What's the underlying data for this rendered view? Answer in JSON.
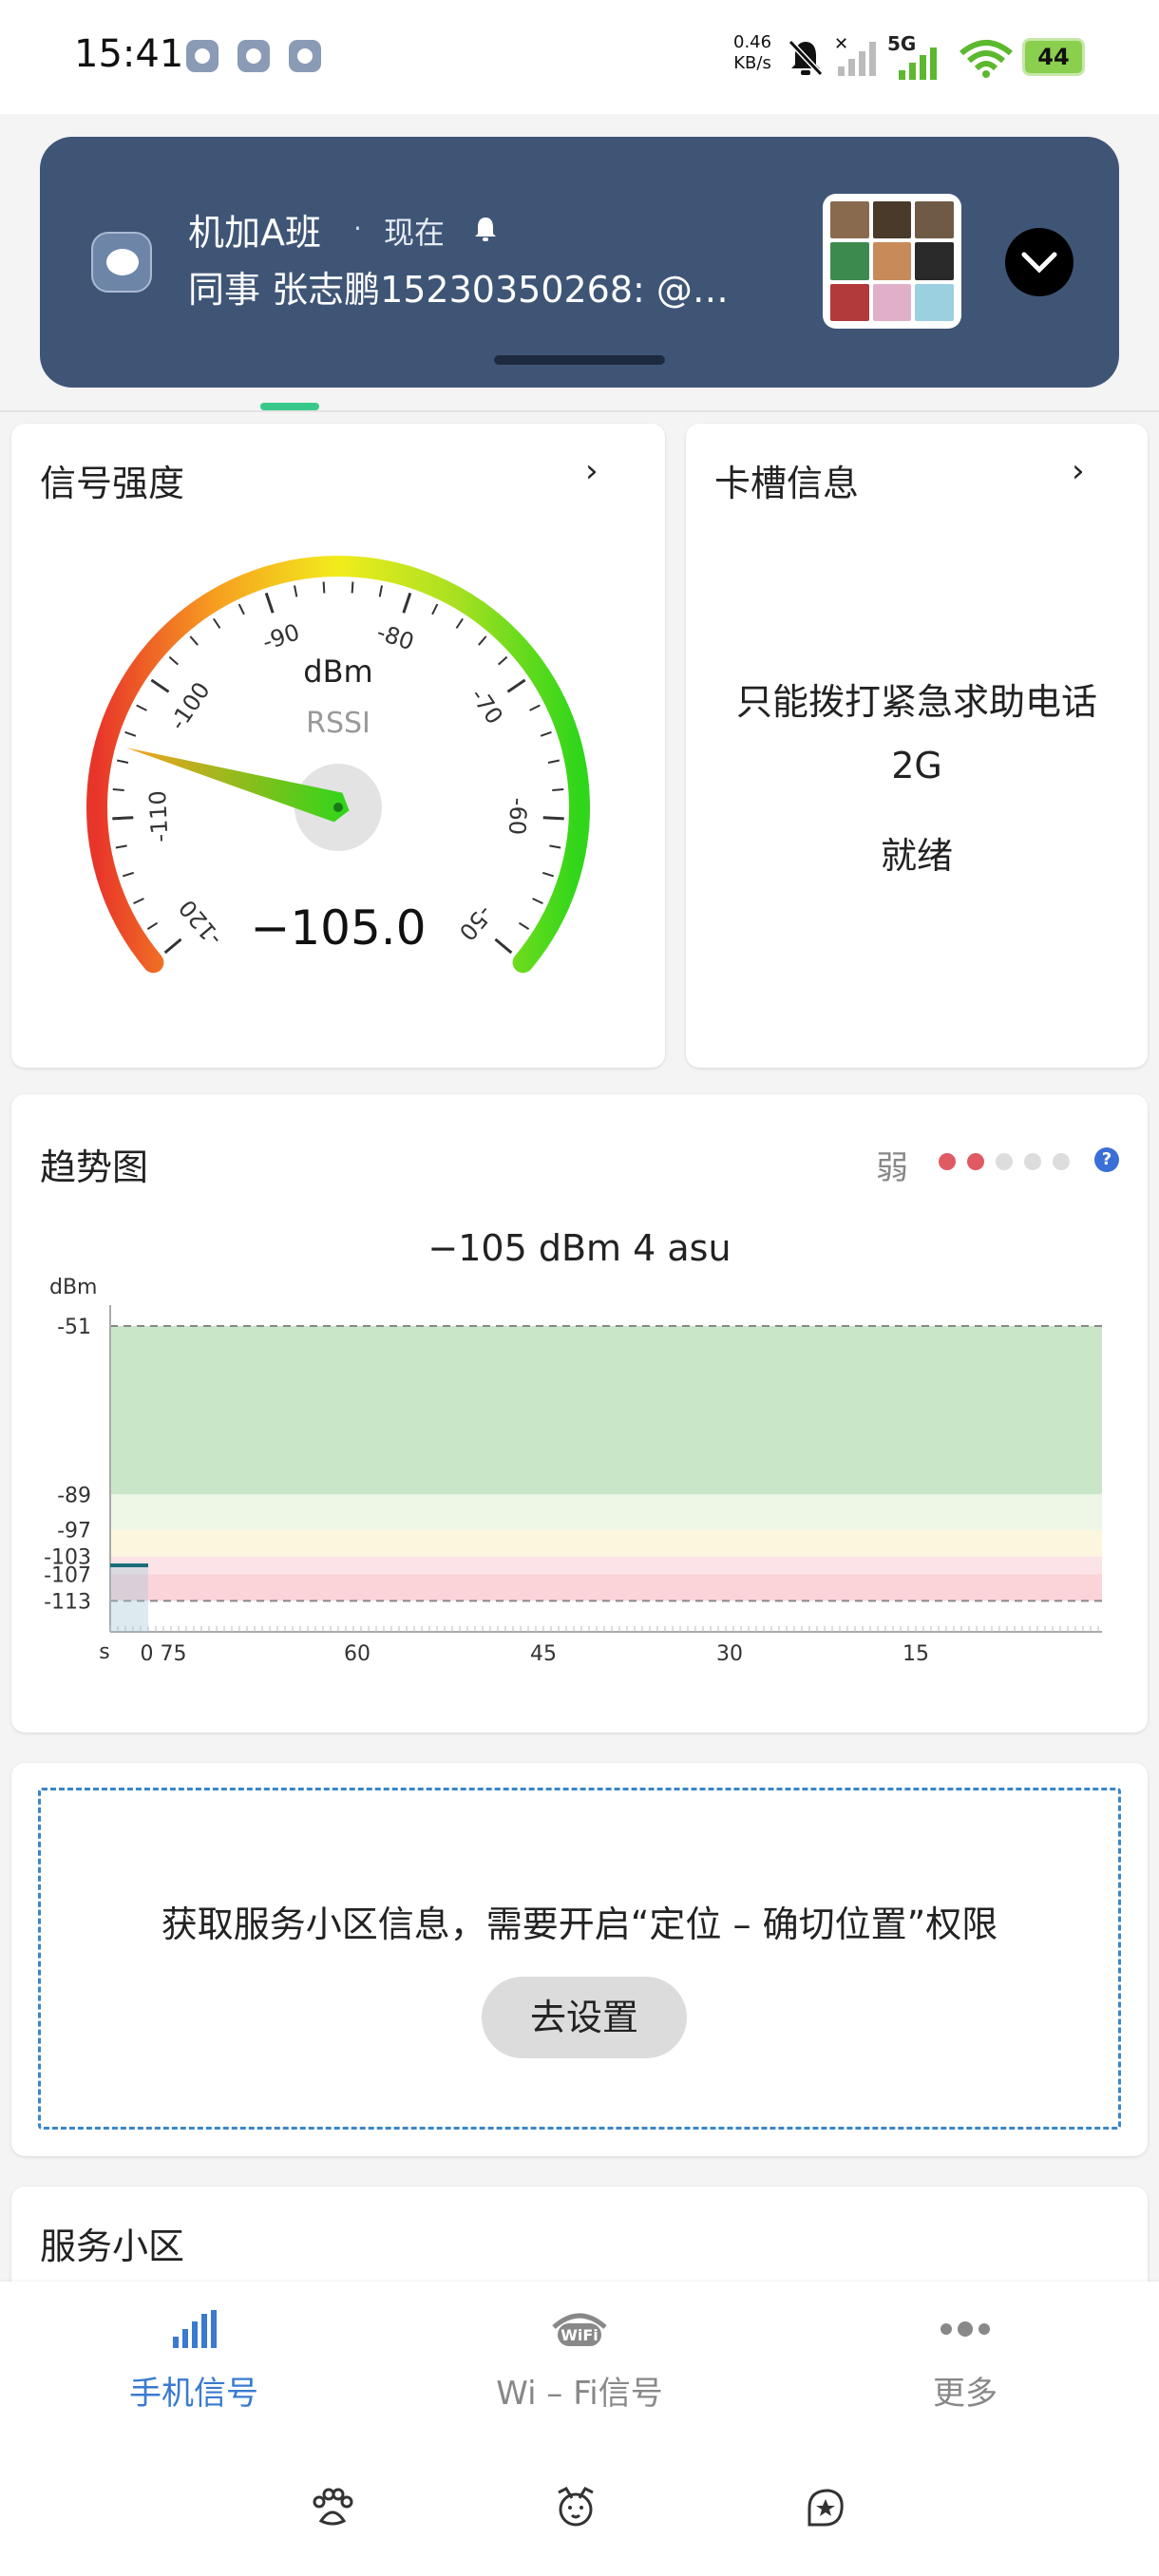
{
  "status_bar": {
    "time": "15:41",
    "net_speed": "0.46",
    "net_unit": "KB/s",
    "network_type": "5G",
    "battery": "44",
    "icons": [
      "chat-app-icon",
      "tiktok-icon",
      "shield-off-icon",
      "mute-bell-icon",
      "no-signal-icon",
      "signal-icon",
      "wifi-icon",
      "battery-icon"
    ]
  },
  "notification": {
    "title": "机加A班",
    "separator": "·",
    "time": "现在",
    "message": "同事   张志鹏15230350268: @…",
    "icons": [
      "chat-app-icon",
      "alarm-bell-icon",
      "thumbnail-grid",
      "chevron-down-icon"
    ]
  },
  "signal_card": {
    "title": "信号强度",
    "unit": "dBm",
    "subtitle": "RSSI",
    "value": "−105.0",
    "gauge": {
      "min": -120,
      "max": -50,
      "reading": -105
    },
    "ticks": [
      "-120",
      "-110",
      "-100",
      "-90",
      "-80",
      "-70",
      "-60",
      "-50"
    ]
  },
  "sim_card": {
    "title": "卡槽信息",
    "lines": [
      "只能拨打紧急求助电话",
      "2G",
      "就绪"
    ]
  },
  "trend_card": {
    "title": "趋势图",
    "level_label": "弱",
    "level_filled": 2,
    "level_total": 5,
    "colors": {
      "filled": "#e05a63",
      "empty": "#dddddd",
      "help": "#3a6fd8"
    },
    "readout": "−105 dBm  4 asu"
  },
  "chart_data": {
    "type": "area",
    "ylabel": "dBm",
    "xlabel": "s",
    "y_ticks": [
      -51,
      -89,
      -97,
      -103,
      -107,
      -113
    ],
    "x_ticks": [
      "0 75",
      "60",
      "45",
      "30",
      "15"
    ],
    "bands": [
      {
        "from": -51,
        "to": -89,
        "color": "#c9e7c8"
      },
      {
        "from": -89,
        "to": -97,
        "color": "#eef6e6"
      },
      {
        "from": -97,
        "to": -103,
        "color": "#fbf6dd"
      },
      {
        "from": -103,
        "to": -107,
        "color": "#fbe3e7"
      },
      {
        "from": -107,
        "to": -113,
        "color": "#fbd4d9"
      }
    ],
    "series": [
      {
        "x": [
          75
        ],
        "y": [
          -105
        ]
      }
    ]
  },
  "permission_card": {
    "message": "获取服务小区信息，需要开启“定位 – 确切位置”权限",
    "button": "去设置"
  },
  "serving_cell": {
    "title": "服务小区"
  },
  "bottom_nav": {
    "items": [
      {
        "label": "手机信号",
        "active": true
      },
      {
        "label": "Wi – Fi信号",
        "active": false
      },
      {
        "label": "更多",
        "active": false
      }
    ],
    "active_color": "#3a7ad0",
    "inactive_color": "#888888"
  }
}
